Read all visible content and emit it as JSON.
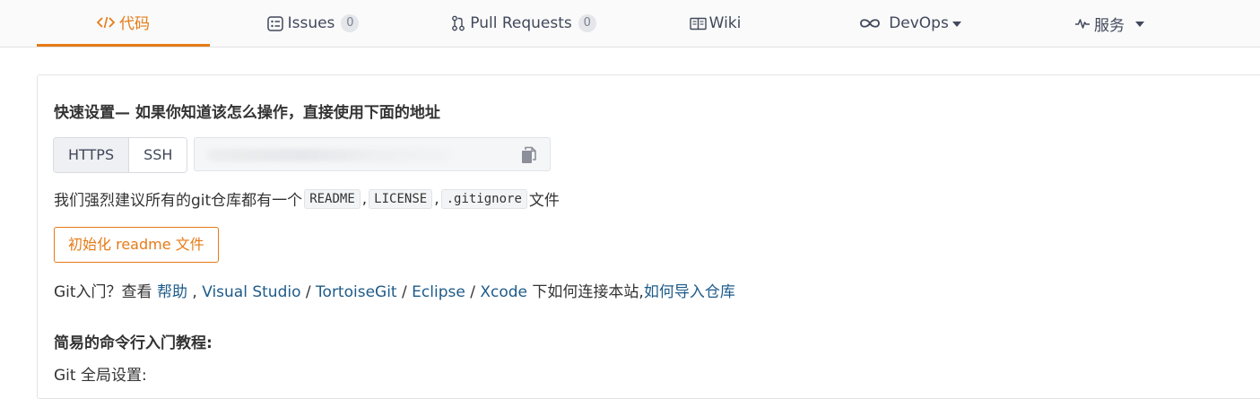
{
  "tabs": [
    {
      "label": "代码",
      "icon": "code-icon",
      "active": true
    },
    {
      "label": "Issues",
      "icon": "issues-icon",
      "count": "0"
    },
    {
      "label": "Pull Requests",
      "icon": "pull-request-icon",
      "count": "0"
    },
    {
      "label": "Wiki",
      "icon": "book-icon"
    },
    {
      "label": "DevOps",
      "icon": "infinity-icon",
      "dropdown": true
    },
    {
      "label": "服务",
      "icon": "pulse-icon",
      "dropdown": true
    }
  ],
  "colors": {
    "accent": "#e67b17",
    "link": "#1e5b8a",
    "text": "#333333"
  },
  "quick_setup": {
    "heading": "快速设置— 如果你知道该怎么操作，直接使用下面的地址",
    "protocols": [
      "HTTPS",
      "SSH"
    ],
    "selected_protocol": "HTTPS",
    "url_value": "",
    "copy_icon": "copy-icon"
  },
  "recommend": {
    "prefix": "我们强烈建议所有的git仓库都有一个",
    "files": [
      "README",
      "LICENSE",
      ".gitignore"
    ],
    "sep": ",",
    "suffix": "文件"
  },
  "init_button": "初始化 readme 文件",
  "help": {
    "prefix": "Git入门？查看",
    "help_link": "帮助",
    "comma": ",",
    "links": [
      "Visual Studio",
      "TortoiseGit",
      "Eclipse",
      "Xcode"
    ],
    "slash": "/",
    "middle": "下如何连接本站,",
    "import_link": "如何导入仓库"
  },
  "cli_heading": "简易的命令行入门教程:",
  "cli_first_line": "Git 全局设置:"
}
